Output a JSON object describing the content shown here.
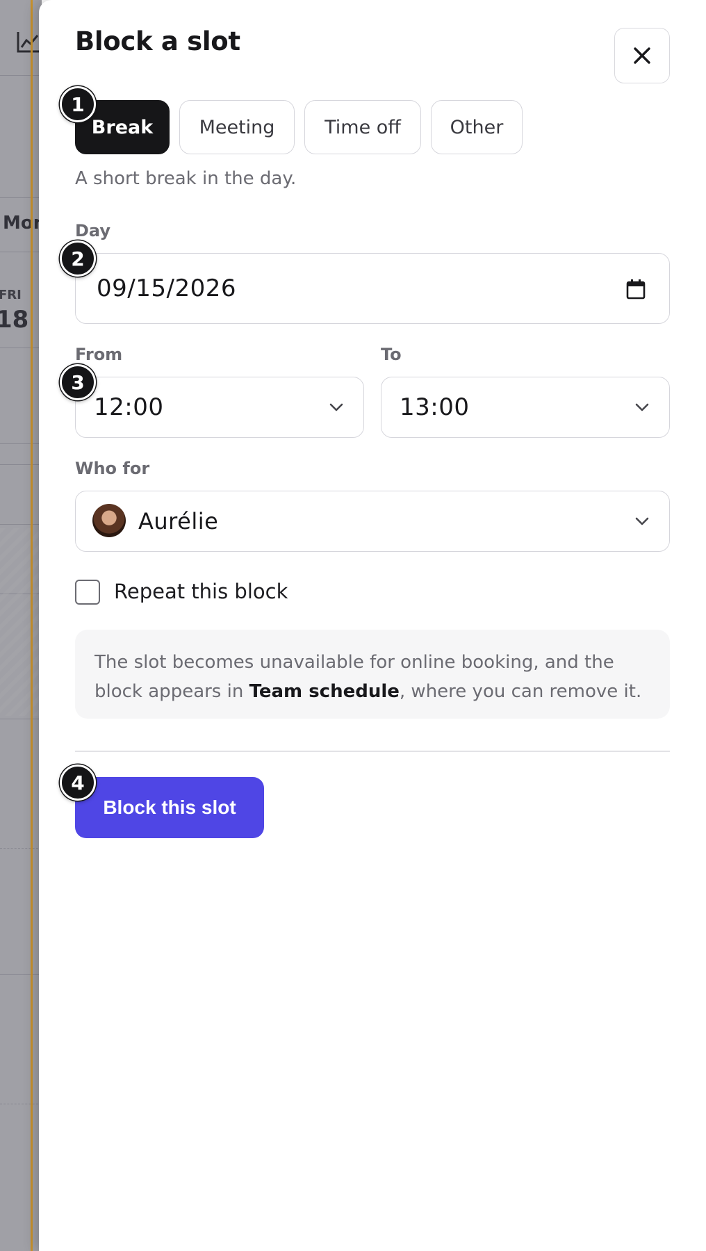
{
  "background_calendar": {
    "column_label": "Mon",
    "day_name": "FRI",
    "day_number": "18"
  },
  "drawer": {
    "title": "Block a slot",
    "close_label": "×",
    "types": [
      {
        "label": "Break",
        "selected": true
      },
      {
        "label": "Meeting",
        "selected": false
      },
      {
        "label": "Time off",
        "selected": false
      },
      {
        "label": "Other",
        "selected": false
      }
    ],
    "type_hint": "A short break in the day.",
    "day": {
      "label": "Day",
      "value": "09/15/2026"
    },
    "from": {
      "label": "From",
      "value": "12:00"
    },
    "to": {
      "label": "To",
      "value": "13:00"
    },
    "who_for": {
      "label": "Who for",
      "value": "Aurélie"
    },
    "repeat": {
      "label": "Repeat this block",
      "checked": false
    },
    "info": {
      "before": "The slot becomes unavailable for online booking, and the block appears in ",
      "link": "Team schedule",
      "after": ", where you can remove it."
    },
    "submit_label": "Block this slot",
    "step_badges": [
      "1",
      "2",
      "3",
      "4"
    ]
  },
  "colors": {
    "accent": "#4f46e5",
    "selected_segment": "#161618",
    "sidebar_accent": "#c9922c"
  }
}
